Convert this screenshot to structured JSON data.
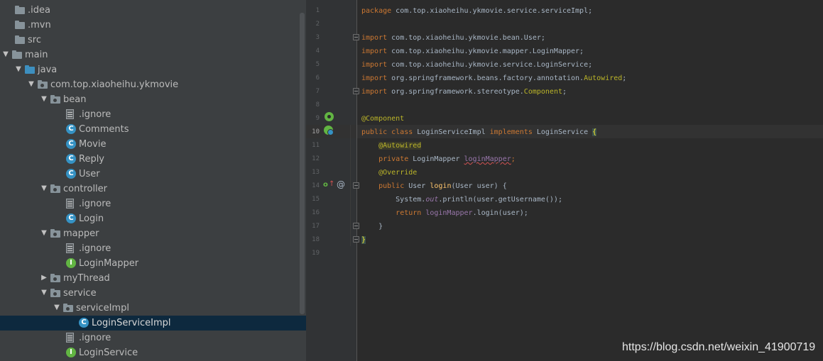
{
  "project_tree": {
    "items": [
      {
        "label": ".idea",
        "type": "folder",
        "depth": 0,
        "expanded": null,
        "selected": false
      },
      {
        "label": ".mvn",
        "type": "folder",
        "depth": 0,
        "expanded": null,
        "selected": false
      },
      {
        "label": "src",
        "type": "folder",
        "depth": 0,
        "expanded": null,
        "selected": false
      },
      {
        "label": "main",
        "type": "folder",
        "depth": 0,
        "expanded": true,
        "selected": false
      },
      {
        "label": "java",
        "type": "source-folder",
        "depth": 1,
        "expanded": true,
        "selected": false
      },
      {
        "label": "com.top.xiaoheihu.ykmovie",
        "type": "package",
        "depth": 2,
        "expanded": true,
        "selected": false
      },
      {
        "label": "bean",
        "type": "package",
        "depth": 3,
        "expanded": true,
        "selected": false
      },
      {
        "label": ".ignore",
        "type": "file",
        "depth": 4,
        "expanded": null,
        "selected": false
      },
      {
        "label": "Comments",
        "type": "class",
        "depth": 4,
        "expanded": null,
        "selected": false
      },
      {
        "label": "Movie",
        "type": "class",
        "depth": 4,
        "expanded": null,
        "selected": false
      },
      {
        "label": "Reply",
        "type": "class",
        "depth": 4,
        "expanded": null,
        "selected": false
      },
      {
        "label": "User",
        "type": "class",
        "depth": 4,
        "expanded": null,
        "selected": false
      },
      {
        "label": "controller",
        "type": "package",
        "depth": 3,
        "expanded": true,
        "selected": false
      },
      {
        "label": ".ignore",
        "type": "file",
        "depth": 4,
        "expanded": null,
        "selected": false
      },
      {
        "label": "Login",
        "type": "class",
        "depth": 4,
        "expanded": null,
        "selected": false
      },
      {
        "label": "mapper",
        "type": "package",
        "depth": 3,
        "expanded": true,
        "selected": false
      },
      {
        "label": ".ignore",
        "type": "file",
        "depth": 4,
        "expanded": null,
        "selected": false
      },
      {
        "label": "LoginMapper",
        "type": "interface",
        "depth": 4,
        "expanded": null,
        "selected": false
      },
      {
        "label": "myThread",
        "type": "package",
        "depth": 3,
        "expanded": false,
        "selected": false
      },
      {
        "label": "service",
        "type": "package",
        "depth": 3,
        "expanded": true,
        "selected": false
      },
      {
        "label": "serviceImpl",
        "type": "package",
        "depth": 4,
        "expanded": true,
        "selected": false
      },
      {
        "label": "LoginServiceImpl",
        "type": "class",
        "depth": 5,
        "expanded": null,
        "selected": true
      },
      {
        "label": ".ignore",
        "type": "file",
        "depth": 4,
        "expanded": null,
        "selected": false
      },
      {
        "label": "LoginService",
        "type": "interface",
        "depth": 4,
        "expanded": null,
        "selected": false
      }
    ]
  },
  "editor": {
    "current_line": 10,
    "line_numbers": [
      "1",
      "2",
      "3",
      "4",
      "5",
      "6",
      "7",
      "8",
      "9",
      "10",
      "11",
      "12",
      "13",
      "14",
      "15",
      "16",
      "17",
      "18",
      "19"
    ],
    "lines": [
      [
        {
          "t": "kw",
          "s": "package "
        },
        {
          "t": "pl",
          "s": "com.top.xiaoheihu.ykmovie.service.serviceImpl;"
        }
      ],
      [],
      [
        {
          "t": "kw",
          "s": "import "
        },
        {
          "t": "pl",
          "s": "com.top.xiaoheihu.ykmovie.bean.User;"
        }
      ],
      [
        {
          "t": "kw",
          "s": "import "
        },
        {
          "t": "pl",
          "s": "com.top.xiaoheihu.ykmovie.mapper.LoginMapper;"
        }
      ],
      [
        {
          "t": "kw",
          "s": "import "
        },
        {
          "t": "pl",
          "s": "com.top.xiaoheihu.ykmovie.service.LoginService;"
        }
      ],
      [
        {
          "t": "kw",
          "s": "import "
        },
        {
          "t": "pl",
          "s": "org.springframework.beans.factory.annotation."
        },
        {
          "t": "ann",
          "s": "Autowired"
        },
        {
          "t": "pl",
          "s": ";"
        }
      ],
      [
        {
          "t": "kw",
          "s": "import "
        },
        {
          "t": "pl",
          "s": "org.springframework.stereotype."
        },
        {
          "t": "ann",
          "s": "Component"
        },
        {
          "t": "pl",
          "s": ";"
        }
      ],
      [],
      [
        {
          "t": "ann",
          "s": "@Component"
        }
      ],
      [
        {
          "t": "kw",
          "s": "public class "
        },
        {
          "t": "pl",
          "s": "LoginServiceImpl "
        },
        {
          "t": "kw",
          "s": "implements "
        },
        {
          "t": "pl",
          "s": "LoginService "
        },
        {
          "t": "brace-hl",
          "s": "{"
        }
      ],
      [
        {
          "t": "pl",
          "s": "    "
        },
        {
          "t": "ann-hl",
          "s": "@Autowired"
        }
      ],
      [
        {
          "t": "pl",
          "s": "    "
        },
        {
          "t": "kw",
          "s": "private "
        },
        {
          "t": "pl",
          "s": "LoginMapper "
        },
        {
          "t": "fld-u",
          "s": "loginMapper"
        },
        {
          "t": "kw",
          "s": ";"
        }
      ],
      [
        {
          "t": "pl",
          "s": "    "
        },
        {
          "t": "ann",
          "s": "@Override"
        }
      ],
      [
        {
          "t": "pl",
          "s": "    "
        },
        {
          "t": "kw",
          "s": "public "
        },
        {
          "t": "pl",
          "s": "User "
        },
        {
          "t": "fn",
          "s": "login"
        },
        {
          "t": "pl",
          "s": "(User user) {"
        }
      ],
      [
        {
          "t": "pl",
          "s": "        System."
        },
        {
          "t": "st",
          "s": "out"
        },
        {
          "t": "pl",
          "s": ".println(user.getUsername());"
        }
      ],
      [
        {
          "t": "pl",
          "s": "        "
        },
        {
          "t": "kw",
          "s": "return "
        },
        {
          "t": "fld",
          "s": "loginMapper"
        },
        {
          "t": "pl",
          "s": ".login(user);"
        }
      ],
      [
        {
          "t": "pl",
          "s": "    }"
        }
      ],
      [
        {
          "t": "brace-hl",
          "s": "}"
        }
      ],
      []
    ]
  },
  "watermark": "https://blog.csdn.net/weixin_41900719",
  "colors": {
    "tree_bg": "#3c3f41",
    "tree_selected": "#0d293e",
    "editor_bg": "#2b2b2b",
    "gutter_bg": "#313335",
    "keyword": "#cc7832",
    "annotation": "#bbb529",
    "field": "#9876aa",
    "method": "#ffc66d",
    "plain": "#a9b7c6"
  }
}
